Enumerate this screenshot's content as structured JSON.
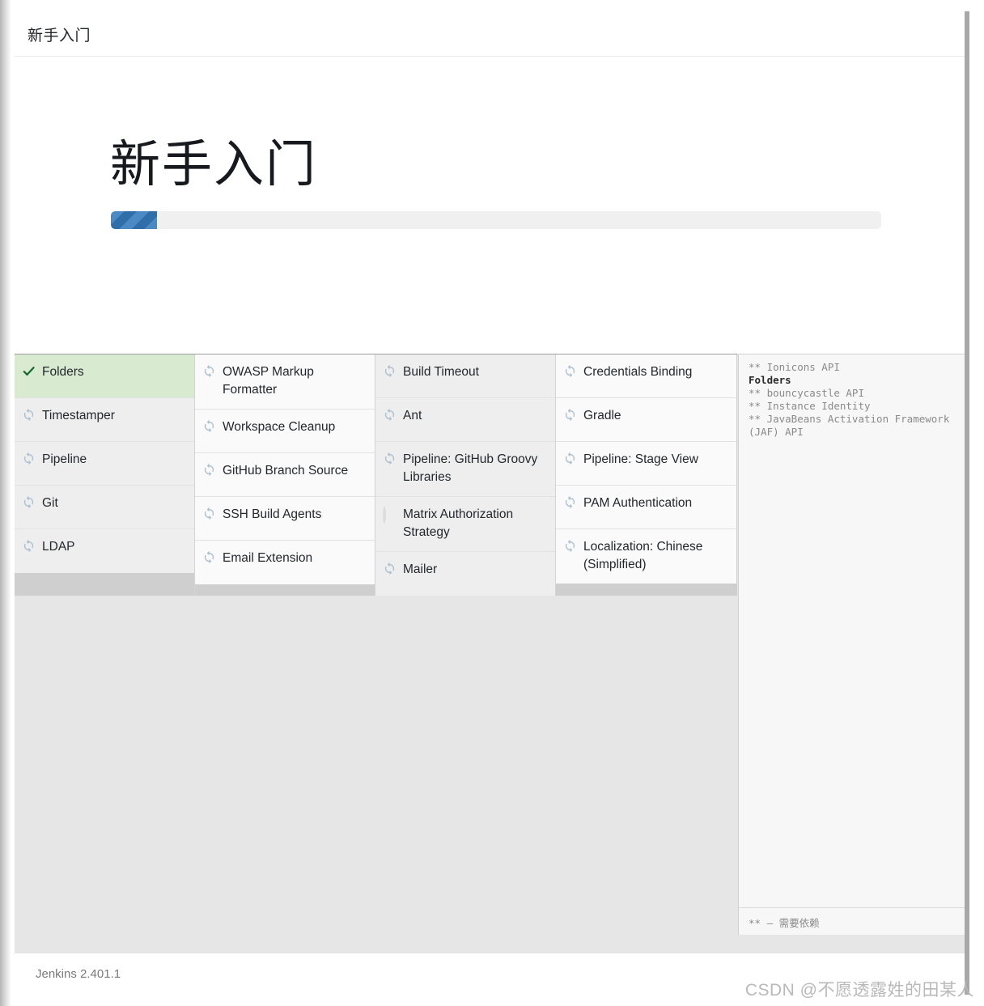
{
  "header": {
    "title": "新手入门"
  },
  "hero": {
    "title": "新手入门",
    "progress_percent": 6
  },
  "plugins": {
    "columns": [
      [
        {
          "label": "Folders",
          "status": "installed",
          "icon": "check-icon"
        },
        {
          "label": "Timestamper",
          "status": "pending",
          "icon": "sync-icon"
        },
        {
          "label": "Pipeline",
          "status": "pending",
          "icon": "sync-icon"
        },
        {
          "label": "Git",
          "status": "pending",
          "icon": "sync-icon"
        },
        {
          "label": "LDAP",
          "status": "pending",
          "icon": "sync-icon"
        }
      ],
      [
        {
          "label": "OWASP Markup Formatter",
          "status": "pending",
          "icon": "sync-icon"
        },
        {
          "label": "Workspace Cleanup",
          "status": "pending",
          "icon": "sync-icon"
        },
        {
          "label": "GitHub Branch Source",
          "status": "pending",
          "icon": "sync-icon"
        },
        {
          "label": "SSH Build Agents",
          "status": "pending",
          "icon": "sync-icon"
        },
        {
          "label": "Email Extension",
          "status": "pending",
          "icon": "sync-icon"
        }
      ],
      [
        {
          "label": "Build Timeout",
          "status": "pending",
          "icon": "sync-icon"
        },
        {
          "label": "Ant",
          "status": "pending",
          "icon": "sync-icon"
        },
        {
          "label": "Pipeline: GitHub Groovy Libraries",
          "status": "pending",
          "icon": "sync-icon"
        },
        {
          "label": "Matrix Authorization Strategy",
          "status": "queued",
          "icon": "circle-icon"
        },
        {
          "label": "Mailer",
          "status": "pending",
          "icon": "sync-icon"
        }
      ],
      [
        {
          "label": "Credentials Binding",
          "status": "pending",
          "icon": "sync-icon"
        },
        {
          "label": "Gradle",
          "status": "pending",
          "icon": "sync-icon"
        },
        {
          "label": "Pipeline: Stage View",
          "status": "pending",
          "icon": "sync-icon"
        },
        {
          "label": "PAM Authentication",
          "status": "pending",
          "icon": "sync-icon"
        },
        {
          "label": "Localization: Chinese (Simplified)",
          "status": "pending",
          "icon": "sync-icon"
        }
      ]
    ]
  },
  "log": {
    "lines": [
      {
        "text": "** Ionicons API",
        "bold": false
      },
      {
        "text": "Folders",
        "bold": true
      },
      {
        "text": "** bouncycastle API",
        "bold": false
      },
      {
        "text": "** Instance Identity",
        "bold": false
      },
      {
        "text": "** JavaBeans Activation Framework (JAF) API",
        "bold": false
      }
    ],
    "footer": "** – 需要依赖"
  },
  "footer": {
    "version": "Jenkins 2.401.1"
  },
  "watermark": {
    "text": "CSDN @不愿透露姓的田某人"
  },
  "colors": {
    "progress_fill_dark": "#2f6ea8",
    "progress_fill_light": "#4a89c4",
    "installed_bg": "#d8ead0",
    "check_green": "#17692a",
    "sync_icon": "#adc0d0"
  }
}
